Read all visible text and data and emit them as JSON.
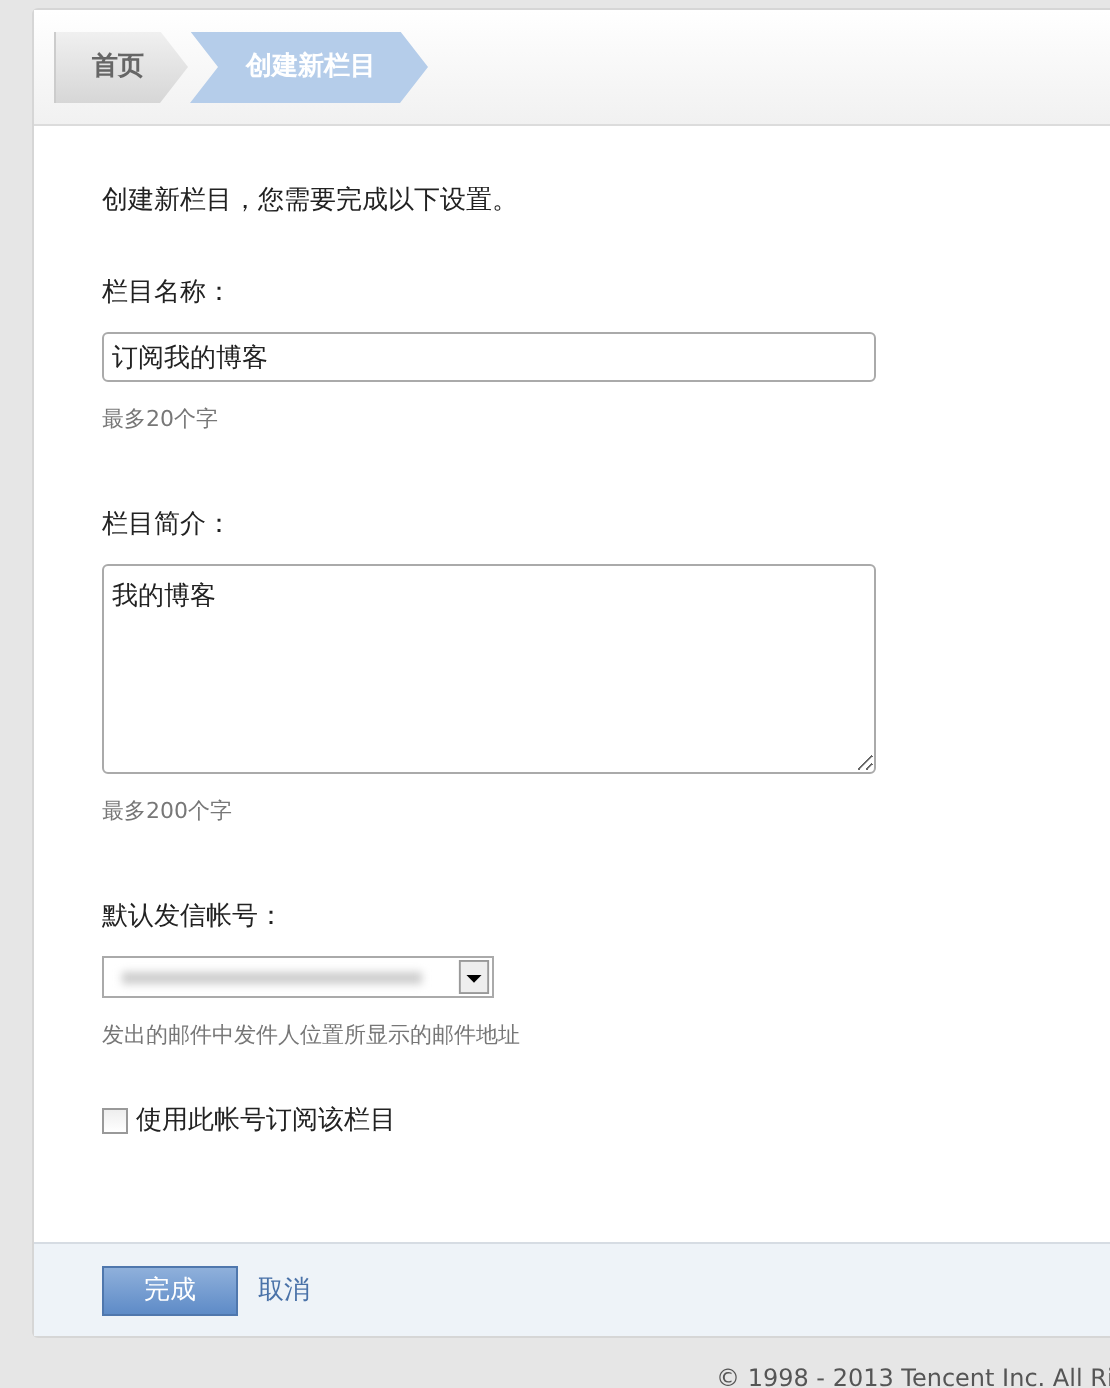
{
  "breadcrumb": [
    {
      "label": "首页",
      "selected": false
    },
    {
      "label": "创建新栏目",
      "selected": true
    }
  ],
  "intro": "创建新栏目，您需要完成以下设置。",
  "name_field": {
    "label": "栏目名称：",
    "value": "订阅我的博客",
    "hint": "最多20个字"
  },
  "description_field": {
    "label": "栏目简介：",
    "value": "我的博客",
    "hint": "最多200个字"
  },
  "sender_field": {
    "label": "默认发信帐号：",
    "hint": "发出的邮件中发件人位置所显示的邮件地址"
  },
  "subscribe_checkbox": {
    "label": "使用此帐号订阅该栏目",
    "checked": false
  },
  "buttons": {
    "submit": "完成",
    "cancel": "取消"
  },
  "copyright": "© 1998 - 2013 Tencent Inc. All Ri"
}
